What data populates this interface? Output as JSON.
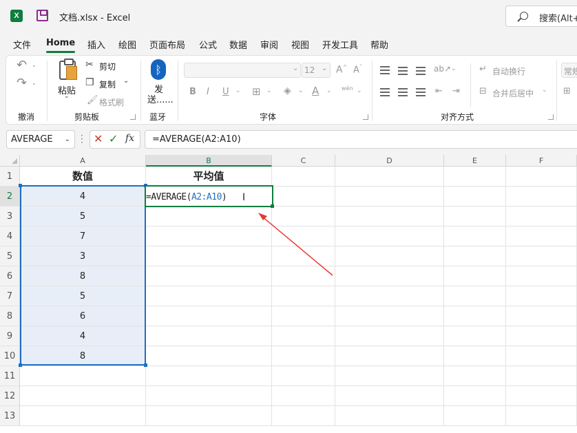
{
  "titlebar": {
    "app_badge": "X",
    "doc_title": "文档.xlsx  -  Excel",
    "search_text": "搜索(Alt+Q)"
  },
  "menu": [
    "文件",
    "Home",
    "插入",
    "绘图",
    "页面布局",
    "公式",
    "数据",
    "审阅",
    "视图",
    "开发工具",
    "帮助"
  ],
  "ribbon": {
    "undo_group": "撤消",
    "clipboard": {
      "paste": "粘贴",
      "cut": "剪切",
      "copy": "复制",
      "format_painter": "格式刷",
      "label": "剪贴板"
    },
    "bluetooth": {
      "send1": "发",
      "send2": "送......",
      "label": "蓝牙"
    },
    "font": {
      "size": "12",
      "label": "字体",
      "wen": "wén"
    },
    "align": {
      "wrap": "自动换行",
      "merge": "合并后居中",
      "label": "对齐方式"
    },
    "number": {
      "format": "常规"
    }
  },
  "formula_bar": {
    "name_box": "AVERAGE",
    "formula": "=AVERAGE(A2:A10)"
  },
  "sheet": {
    "columns": [
      "A",
      "B",
      "C",
      "D",
      "E",
      "F"
    ],
    "rows": [
      "1",
      "2",
      "3",
      "4",
      "5",
      "6",
      "7",
      "8",
      "9",
      "10",
      "11",
      "12",
      "13"
    ],
    "A1": "数值",
    "B1": "平均值",
    "values": [
      "4",
      "5",
      "7",
      "3",
      "8",
      "5",
      "6",
      "4",
      "8"
    ],
    "edit": {
      "prefix": "=AVERAGE(",
      "ref": "A2:A10",
      "suffix": ")"
    }
  },
  "colors": {
    "accent": "#107c41",
    "range": "#1e6fbf",
    "arrow": "#e53935"
  }
}
